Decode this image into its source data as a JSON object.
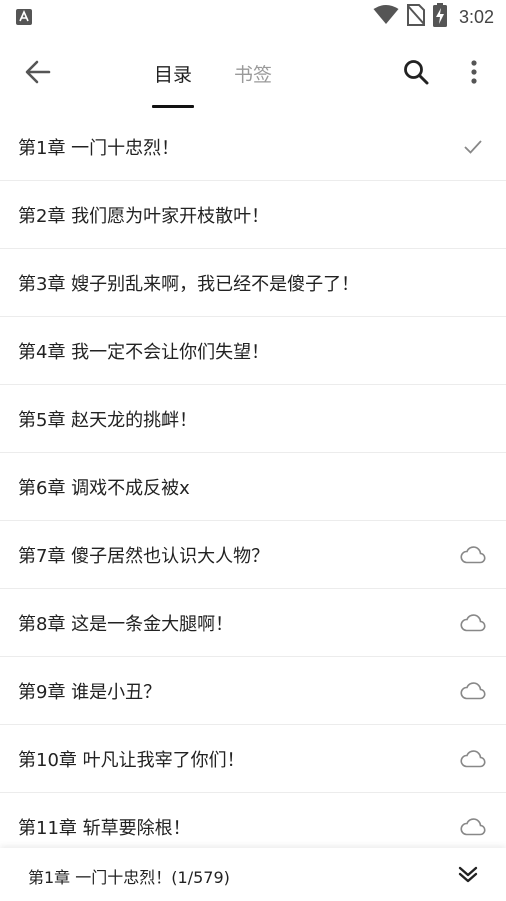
{
  "status_bar": {
    "time": "3:02",
    "icons": [
      "app-notification-icon",
      "wifi-icon",
      "no-sim-icon",
      "battery-charging-icon"
    ]
  },
  "toolbar": {
    "back_icon": "arrow-left-icon",
    "tabs": [
      {
        "label": "目录",
        "active": true
      },
      {
        "label": "书签",
        "active": false
      }
    ],
    "search_icon": "search-icon",
    "more_icon": "more-vertical-icon"
  },
  "chapters": [
    {
      "title": "第1章 一门十忠烈！",
      "status": "read"
    },
    {
      "title": "第2章 我们愿为叶家开枝散叶！",
      "status": "downloaded"
    },
    {
      "title": "第3章 嫂子别乱来啊，我已经不是傻子了！",
      "status": "downloaded"
    },
    {
      "title": "第4章 我一定不会让你们失望！",
      "status": "downloaded"
    },
    {
      "title": "第5章 赵天龙的挑衅！",
      "status": "downloaded"
    },
    {
      "title": "第6章 调戏不成反被x",
      "status": "downloaded"
    },
    {
      "title": "第7章 傻子居然也认识大人物？",
      "status": "cloud"
    },
    {
      "title": "第8章 这是一条金大腿啊！",
      "status": "cloud"
    },
    {
      "title": "第9章 谁是小丑？",
      "status": "cloud"
    },
    {
      "title": "第10章 叶凡让我宰了你们！",
      "status": "cloud"
    },
    {
      "title": "第11章 斩草要除根！",
      "status": "cloud"
    }
  ],
  "bottom_bar": {
    "current": "第1章 一门十忠烈！(1/579)",
    "chevron_icon": "chevrons-down-icon"
  },
  "colors": {
    "text": "#222222",
    "inactive_tab": "#9a9a9a",
    "icon": "#777777",
    "divider": "#ececec"
  }
}
